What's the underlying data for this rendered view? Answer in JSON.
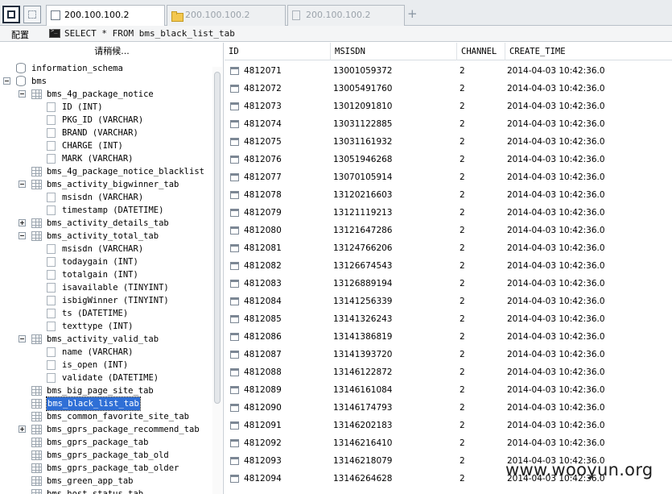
{
  "tabbar": {
    "tabs": [
      {
        "label": "200.100.100.2",
        "active": true,
        "icon": "terminal-window-icon"
      },
      {
        "label": "200.100.100.2",
        "active": false,
        "icon": "folder-icon"
      },
      {
        "label": "200.100.100.2",
        "active": false,
        "icon": "document-icon"
      }
    ],
    "new_tab": "+"
  },
  "subbar": {
    "config_label": "配置",
    "query": "SELECT * FROM bms_black_list_tab"
  },
  "tree": {
    "filter_placeholder": "请稍候...",
    "nodes": [
      {
        "label": "information_schema",
        "type": "db",
        "depth": 0,
        "expander": "none"
      },
      {
        "label": "bms",
        "type": "db",
        "depth": 0,
        "expander": "minus"
      },
      {
        "label": "bms_4g_package_notice",
        "type": "table",
        "depth": 1,
        "expander": "minus"
      },
      {
        "label": "ID (INT)",
        "type": "column",
        "depth": 2,
        "expander": "none"
      },
      {
        "label": "PKG_ID (VARCHAR)",
        "type": "column",
        "depth": 2,
        "expander": "none"
      },
      {
        "label": "BRAND (VARCHAR)",
        "type": "column",
        "depth": 2,
        "expander": "none"
      },
      {
        "label": "CHARGE (INT)",
        "type": "column",
        "depth": 2,
        "expander": "none"
      },
      {
        "label": "MARK (VARCHAR)",
        "type": "column",
        "depth": 2,
        "expander": "none"
      },
      {
        "label": "bms_4g_package_notice_blacklist",
        "type": "table",
        "depth": 1,
        "expander": "none"
      },
      {
        "label": "bms_activity_bigwinner_tab",
        "type": "table",
        "depth": 1,
        "expander": "minus"
      },
      {
        "label": "msisdn (VARCHAR)",
        "type": "column",
        "depth": 2,
        "expander": "none"
      },
      {
        "label": "timestamp (DATETIME)",
        "type": "column",
        "depth": 2,
        "expander": "none"
      },
      {
        "label": "bms_activity_details_tab",
        "type": "table",
        "depth": 1,
        "expander": "plus"
      },
      {
        "label": "bms_activity_total_tab",
        "type": "table",
        "depth": 1,
        "expander": "minus"
      },
      {
        "label": "msisdn (VARCHAR)",
        "type": "column",
        "depth": 2,
        "expander": "none"
      },
      {
        "label": "todaygain (INT)",
        "type": "column",
        "depth": 2,
        "expander": "none"
      },
      {
        "label": "totalgain (INT)",
        "type": "column",
        "depth": 2,
        "expander": "none"
      },
      {
        "label": "isavailable (TINYINT)",
        "type": "column",
        "depth": 2,
        "expander": "none"
      },
      {
        "label": "isbigWinner (TINYINT)",
        "type": "column",
        "depth": 2,
        "expander": "none"
      },
      {
        "label": "ts (DATETIME)",
        "type": "column",
        "depth": 2,
        "expander": "none"
      },
      {
        "label": "texttype (INT)",
        "type": "column",
        "depth": 2,
        "expander": "none"
      },
      {
        "label": "bms_activity_valid_tab",
        "type": "table",
        "depth": 1,
        "expander": "minus"
      },
      {
        "label": "name (VARCHAR)",
        "type": "column",
        "depth": 2,
        "expander": "none"
      },
      {
        "label": "is_open (INT)",
        "type": "column",
        "depth": 2,
        "expander": "none"
      },
      {
        "label": "validate (DATETIME)",
        "type": "column",
        "depth": 2,
        "expander": "none"
      },
      {
        "label": "bms_big_page_site_tab",
        "type": "table",
        "depth": 1,
        "expander": "none"
      },
      {
        "label": "bms_black_list_tab",
        "type": "table",
        "depth": 1,
        "expander": "none",
        "selected": true
      },
      {
        "label": "bms_common_favorite_site_tab",
        "type": "table",
        "depth": 1,
        "expander": "none"
      },
      {
        "label": "bms_gprs_package_recommend_tab",
        "type": "table",
        "depth": 1,
        "expander": "plus"
      },
      {
        "label": "bms_gprs_package_tab",
        "type": "table",
        "depth": 1,
        "expander": "none"
      },
      {
        "label": "bms_gprs_package_tab_old",
        "type": "table",
        "depth": 1,
        "expander": "none"
      },
      {
        "label": "bms_gprs_package_tab_older",
        "type": "table",
        "depth": 1,
        "expander": "none"
      },
      {
        "label": "bms_green_app_tab",
        "type": "table",
        "depth": 1,
        "expander": "none"
      },
      {
        "label": "bms_host_status_tab",
        "type": "table",
        "depth": 1,
        "expander": "none"
      }
    ]
  },
  "grid": {
    "columns": [
      "ID",
      "MSISDN",
      "CHANNEL",
      "CREATE_TIME"
    ],
    "rows": [
      [
        "4812071",
        "13001059372",
        "2",
        "2014-04-03 10:42:36.0"
      ],
      [
        "4812072",
        "13005491760",
        "2",
        "2014-04-03 10:42:36.0"
      ],
      [
        "4812073",
        "13012091810",
        "2",
        "2014-04-03 10:42:36.0"
      ],
      [
        "4812074",
        "13031122885",
        "2",
        "2014-04-03 10:42:36.0"
      ],
      [
        "4812075",
        "13031161932",
        "2",
        "2014-04-03 10:42:36.0"
      ],
      [
        "4812076",
        "13051946268",
        "2",
        "2014-04-03 10:42:36.0"
      ],
      [
        "4812077",
        "13070105914",
        "2",
        "2014-04-03 10:42:36.0"
      ],
      [
        "4812078",
        "13120216603",
        "2",
        "2014-04-03 10:42:36.0"
      ],
      [
        "4812079",
        "13121119213",
        "2",
        "2014-04-03 10:42:36.0"
      ],
      [
        "4812080",
        "13121647286",
        "2",
        "2014-04-03 10:42:36.0"
      ],
      [
        "4812081",
        "13124766206",
        "2",
        "2014-04-03 10:42:36.0"
      ],
      [
        "4812082",
        "13126674543",
        "2",
        "2014-04-03 10:42:36.0"
      ],
      [
        "4812083",
        "13126889194",
        "2",
        "2014-04-03 10:42:36.0"
      ],
      [
        "4812084",
        "13141256339",
        "2",
        "2014-04-03 10:42:36.0"
      ],
      [
        "4812085",
        "13141326243",
        "2",
        "2014-04-03 10:42:36.0"
      ],
      [
        "4812086",
        "13141386819",
        "2",
        "2014-04-03 10:42:36.0"
      ],
      [
        "4812087",
        "13141393720",
        "2",
        "2014-04-03 10:42:36.0"
      ],
      [
        "4812088",
        "13146122872",
        "2",
        "2014-04-03 10:42:36.0"
      ],
      [
        "4812089",
        "13146161084",
        "2",
        "2014-04-03 10:42:36.0"
      ],
      [
        "4812090",
        "13146174793",
        "2",
        "2014-04-03 10:42:36.0"
      ],
      [
        "4812091",
        "13146202183",
        "2",
        "2014-04-03 10:42:36.0"
      ],
      [
        "4812092",
        "13146216410",
        "2",
        "2014-04-03 10:42:36.0"
      ],
      [
        "4812093",
        "13146218079",
        "2",
        "2014-04-03 10:42:36.0"
      ],
      [
        "4812094",
        "13146264628",
        "2",
        "2014-04-03 10:42:36.0"
      ]
    ]
  },
  "watermark": "www.wooyun.org",
  "colors": {
    "selection": "#2f6fd6",
    "folder": "#f3c74e"
  }
}
